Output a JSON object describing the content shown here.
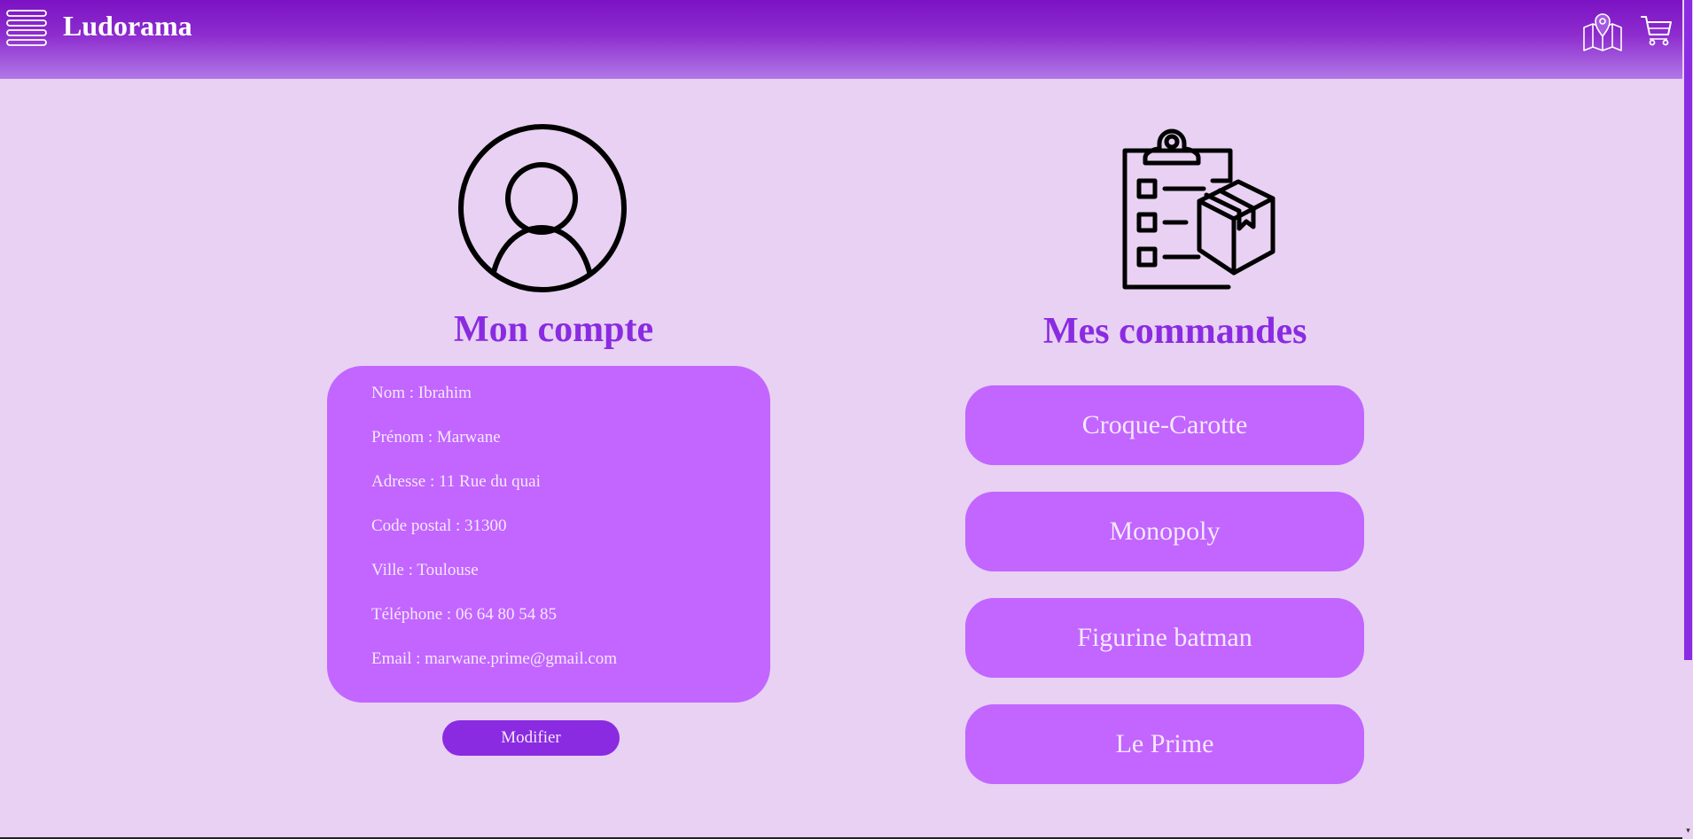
{
  "header": {
    "brand": "Ludorama",
    "menu_icon": "hamburger-menu-icon",
    "map_icon": "map-pin-icon",
    "cart_icon": "shopping-cart-icon"
  },
  "account": {
    "title": "Mon compte",
    "icon": "user-profile-icon",
    "fields": [
      "Nom : Ibrahim",
      "Prénom : Marwane",
      "Adresse : 11 Rue du quai",
      "Code postal : 31300",
      "Ville : Toulouse",
      "Téléphone : 06 64 80 54 85",
      "Email : marwane.prime@gmail.com"
    ],
    "modify_label": "Modifier"
  },
  "orders": {
    "title": "Mes commandes",
    "icon": "clipboard-package-icon",
    "items": [
      "Croque-Carotte",
      "Monopoly",
      "Figurine batman",
      "Le Prime"
    ]
  },
  "colors": {
    "background": "#e8d1f2",
    "header_top": "#7b12c3",
    "header_bottom": "#b178e6",
    "accent": "#8a2be2",
    "card": "#c266ff",
    "card_text": "#f4e8fc"
  }
}
